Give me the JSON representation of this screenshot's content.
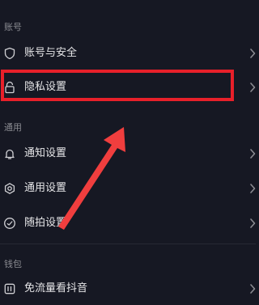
{
  "top_glyph": "⌃",
  "sections": {
    "account": "账号",
    "general": "通用",
    "wallet": "钱包"
  },
  "rows": {
    "account_security": {
      "label": "账号与安全",
      "icon": "shield-icon"
    },
    "privacy": {
      "label": "隐私设置",
      "icon": "lock-icon"
    },
    "notifications": {
      "label": "通知设置",
      "icon": "bell-icon"
    },
    "general_settings": {
      "label": "通用设置",
      "icon": "gear-icon"
    },
    "snap_settings": {
      "label": "随拍设置",
      "icon": "circle-check-icon"
    },
    "free_data": {
      "label": "免流量看抖音",
      "icon": "data-card-icon"
    }
  },
  "colors": {
    "background": "#161823",
    "highlight": "#e8202a",
    "arrow": "#f03e3e",
    "section_label": "#8a8b91",
    "row_text": "#e6e6e8"
  }
}
